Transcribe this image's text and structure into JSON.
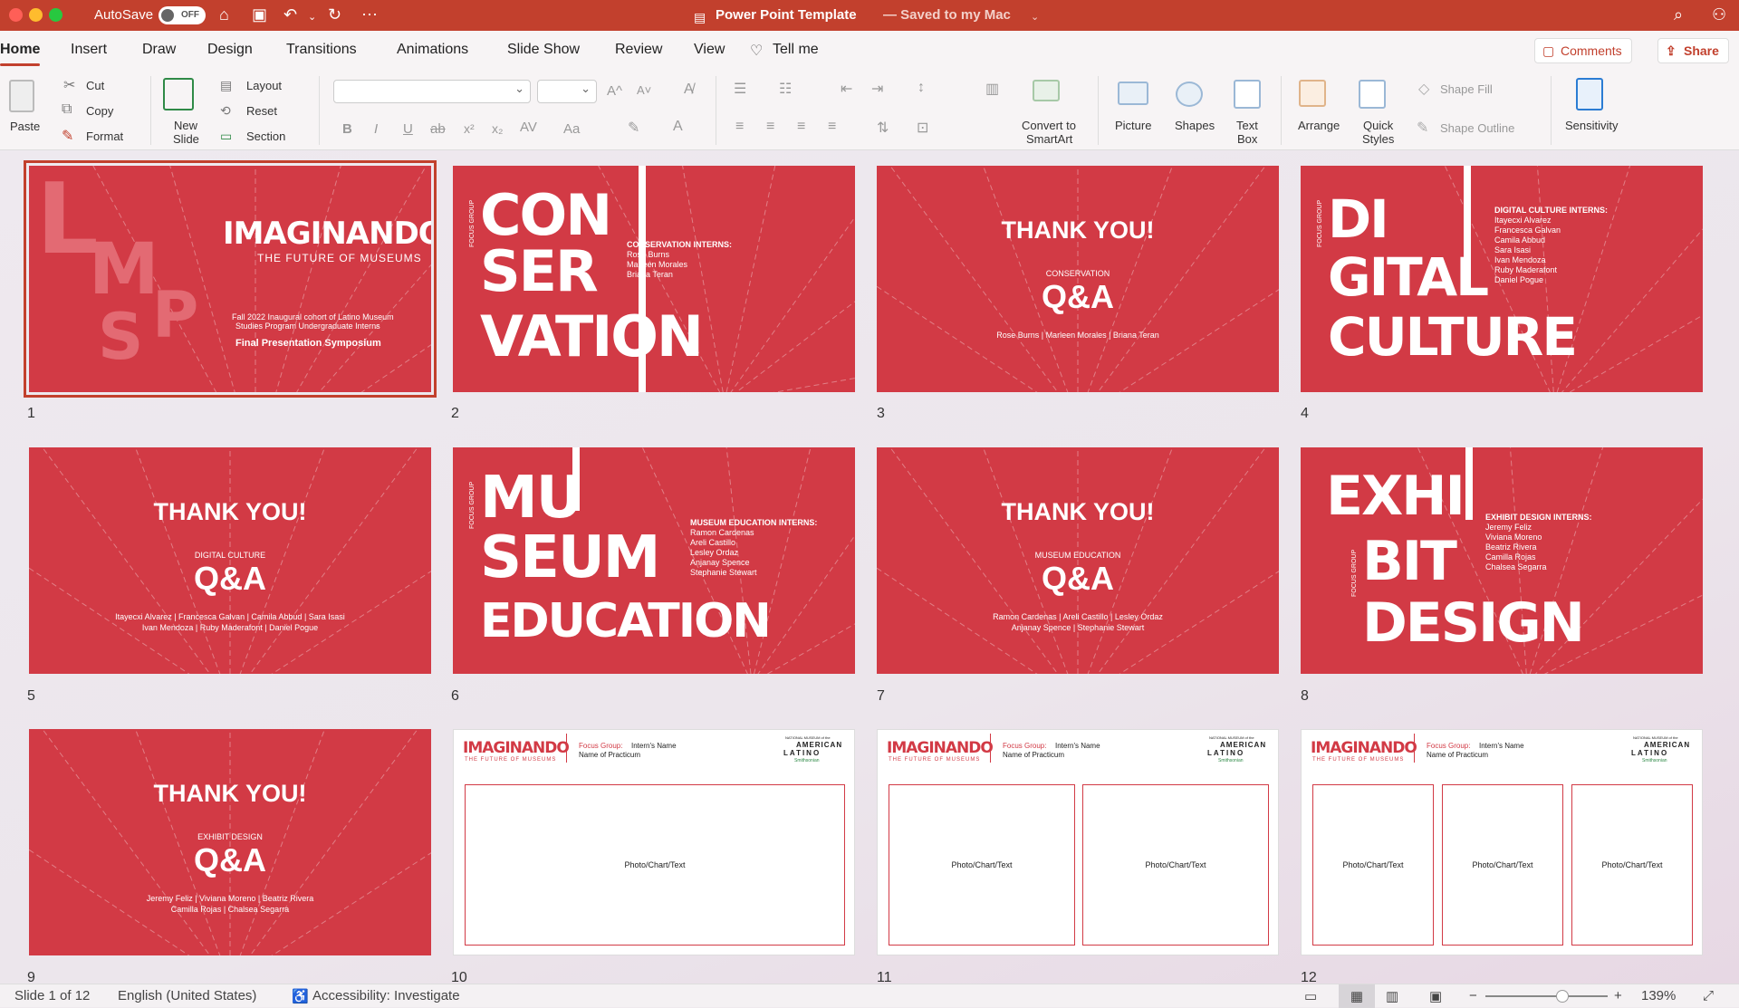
{
  "titlebar": {
    "autosave": "AutoSave",
    "toggle": "OFF",
    "title": "Power Point Template",
    "saved": "— Saved to my Mac"
  },
  "tabs": [
    "Home",
    "Insert",
    "Draw",
    "Design",
    "Transitions",
    "Animations",
    "Slide Show",
    "Review",
    "View"
  ],
  "tellme": "Tell me",
  "top_buttons": {
    "comments": "Comments",
    "share": "Share"
  },
  "ribbon": {
    "paste": "Paste",
    "cut": "Cut",
    "copy": "Copy",
    "format": "Format",
    "new_slide_1": "New",
    "new_slide_2": "Slide",
    "layout": "Layout",
    "reset": "Reset",
    "section": "Section",
    "convert_1": "Convert to",
    "convert_2": "SmartArt",
    "picture": "Picture",
    "shapes": "Shapes",
    "textbox_1": "Text",
    "textbox_2": "Box",
    "arrange": "Arrange",
    "quick_1": "Quick",
    "quick_2": "Styles",
    "shape_fill": "Shape Fill",
    "shape_outline": "Shape Outline",
    "sensitivity": "Sensitivity",
    "bold": "B",
    "italic": "I",
    "underline": "U",
    "strike": "ab",
    "super": "x²",
    "sub": "x₂",
    "spacing": "AV",
    "case": "Aa"
  },
  "slides": {
    "s1": {
      "num": "1",
      "title": "IMAGINANDO",
      "subtitle": "THE FUTURE OF MUSEUMS",
      "line1": "Fall 2022 Inaugural cohort of Latino Museum",
      "line2": "Studies Program Undergraduate Interns",
      "symposium": "Final Presentation Symposium",
      "lmsp_l": "L",
      "lmsp_m": "M",
      "lmsp_s": "S",
      "lmsp_p": "P"
    },
    "s2": {
      "num": "2",
      "w1": "CON",
      "w2": "SER",
      "w3": "VATION",
      "focus": "FOCUS GROUP",
      "heading": "CONSERVATION INTERNS:",
      "names": [
        "Rose Burns",
        "Marleen Morales",
        "Briana Teran"
      ]
    },
    "s3": {
      "num": "3",
      "thanks": "THANK YOU!",
      "group": "CONSERVATION",
      "qa": "Q&A",
      "names1": "Rose Burns  |  Marleen Morales  |  Briana Teran",
      "names2": ""
    },
    "s4": {
      "num": "4",
      "w1": "DI",
      "w2": "GITAL",
      "w3": "CULTURE",
      "focus": "FOCUS GROUP",
      "heading": "DIGITAL CULTURE INTERNS:",
      "names": [
        "Itayecxi Alvarez",
        "Francesca Galvan",
        "Camila Abbud",
        "Sara Isasi",
        "Ivan Mendoza",
        "Ruby Maderafont",
        "Daniel Pogue"
      ]
    },
    "s5": {
      "num": "5",
      "thanks": "THANK YOU!",
      "group": "DIGITAL CULTURE",
      "qa": "Q&A",
      "names1": "Itayecxi Alvarez  |  Francesca Galvan  |  Camila Abbud  |  Sara Isasi",
      "names2": "Ivan Mendoza  |  Ruby Maderafont  |  Daniel Pogue"
    },
    "s6": {
      "num": "6",
      "w1": "MU",
      "w2": "SEUM",
      "w3": "EDUCATION",
      "focus": "FOCUS GROUP",
      "heading": "MUSEUM EDUCATION INTERNS:",
      "names": [
        "Ramon Cardenas",
        "Areli Castillo",
        "Lesley Ordaz",
        "Anjanay Spence",
        "Stephanie Stewart"
      ]
    },
    "s7": {
      "num": "7",
      "thanks": "THANK YOU!",
      "group": "MUSEUM EDUCATION",
      "qa": "Q&A",
      "names1": "Ramon Cardenas  |  Areli Castillo  |  Lesley Ordaz",
      "names2": "Anjanay Spence  |  Stephanie Stewart"
    },
    "s8": {
      "num": "8",
      "w1": "EXHI",
      "w2": "BIT",
      "w3": "DESIGN",
      "focus": "FOCUS GROUP",
      "heading": "EXHIBIT DESIGN INTERNS:",
      "names": [
        "Jeremy Feliz",
        "Viviana Moreno",
        "Beatriz Rivera",
        "Camilla Rojas",
        "Chalsea Segarra"
      ]
    },
    "s9": {
      "num": "9",
      "thanks": "THANK YOU!",
      "group": "EXHIBIT DESIGN",
      "qa": "Q&A",
      "names1": "Jeremy Feliz  |  Viviana Moreno  |  Beatriz Rivera",
      "names2": "Camilla Rojas  |  Chalsea Segarra"
    },
    "template": {
      "logo": "IMAGINANDO",
      "logo_sub": "THE FUTURE OF MUSEUMS",
      "focus_label": "Focus Group:",
      "intern": "Intern's Name",
      "practicum": "Name of Practicum",
      "nm_small": "NATIONAL MUSEUM of the",
      "nm_american": "AMERICAN",
      "nm_latino": "LATINO",
      "nm_smith": "Smithsonian",
      "ph": "Photo/Chart/Text"
    },
    "s10": {
      "num": "10"
    },
    "s11": {
      "num": "11"
    },
    "s12": {
      "num": "12"
    }
  },
  "status": {
    "slide": "Slide 1 of 12",
    "lang": "English (United States)",
    "access": "Accessibility: Investigate",
    "zoom": "139%"
  },
  "colors": {
    "accent": "#c2402d",
    "slide_red": "#d23a45"
  }
}
